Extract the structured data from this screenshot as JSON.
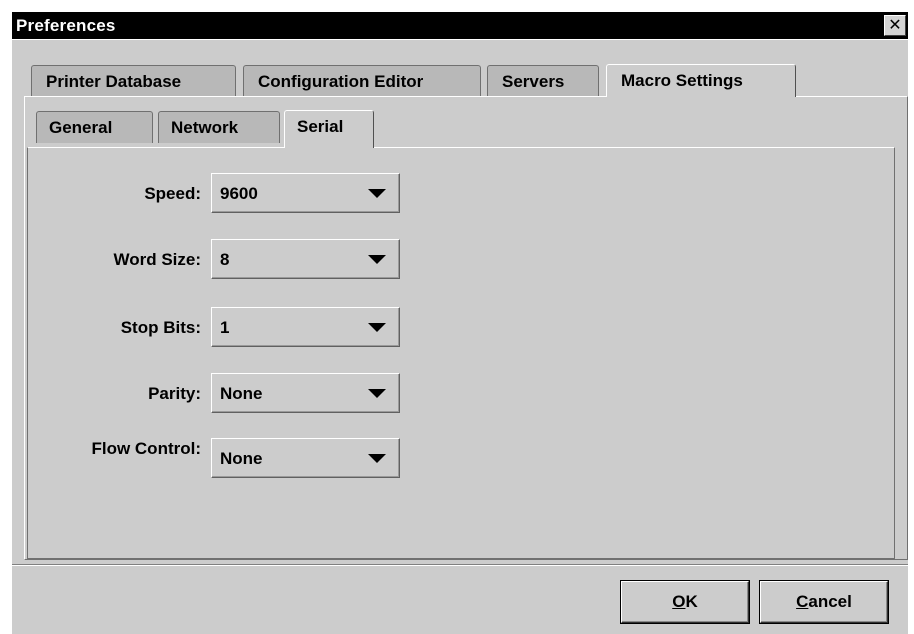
{
  "window": {
    "title": "Preferences",
    "close_glyph": "✕"
  },
  "outer_tabs": [
    {
      "label": "Printer Database",
      "selected": false
    },
    {
      "label": "Configuration Editor",
      "selected": false
    },
    {
      "label": "Servers",
      "selected": false
    },
    {
      "label": "Macro Settings",
      "selected": true
    }
  ],
  "inner_tabs": [
    {
      "label": "General",
      "selected": false
    },
    {
      "label": "Network",
      "selected": false
    },
    {
      "label": "Serial",
      "selected": true
    }
  ],
  "serial": {
    "speed": {
      "label": "Speed:",
      "value": "9600"
    },
    "word_size": {
      "label": "Word Size:",
      "value": "8"
    },
    "stop_bits": {
      "label": "Stop Bits:",
      "value": "1"
    },
    "parity": {
      "label": "Parity:",
      "value": "None"
    },
    "flow_control": {
      "label": "Flow Control:",
      "value": "None"
    }
  },
  "buttons": {
    "ok": {
      "mnemonic": "O",
      "rest": "K"
    },
    "cancel": {
      "mnemonic": "C",
      "rest": "ancel"
    }
  },
  "icons": {
    "close": "close-icon",
    "dropdown": "chevron-down-icon"
  }
}
